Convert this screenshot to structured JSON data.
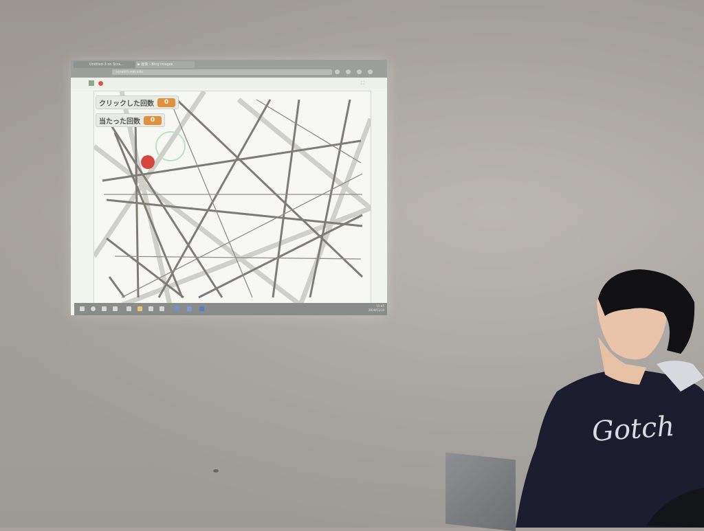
{
  "browser": {
    "tabs": [
      "",
      "Untitled-3 on Scra...",
      "▶ 画像 - Bing images"
    ],
    "url": "scratch.mit.edu"
  },
  "game": {
    "click_label": "クリックした回数",
    "click_value": "0",
    "hit_label": "当たった回数",
    "hit_value": "0"
  },
  "taskbar": {
    "time": "15:45",
    "date": "2019/11/10"
  },
  "colors": {
    "wall": "#aca8a3",
    "counter": "#e0913e",
    "ball": "#d6453e",
    "line_dark": "#7c7a73",
    "line_light": "#cdcec8"
  }
}
